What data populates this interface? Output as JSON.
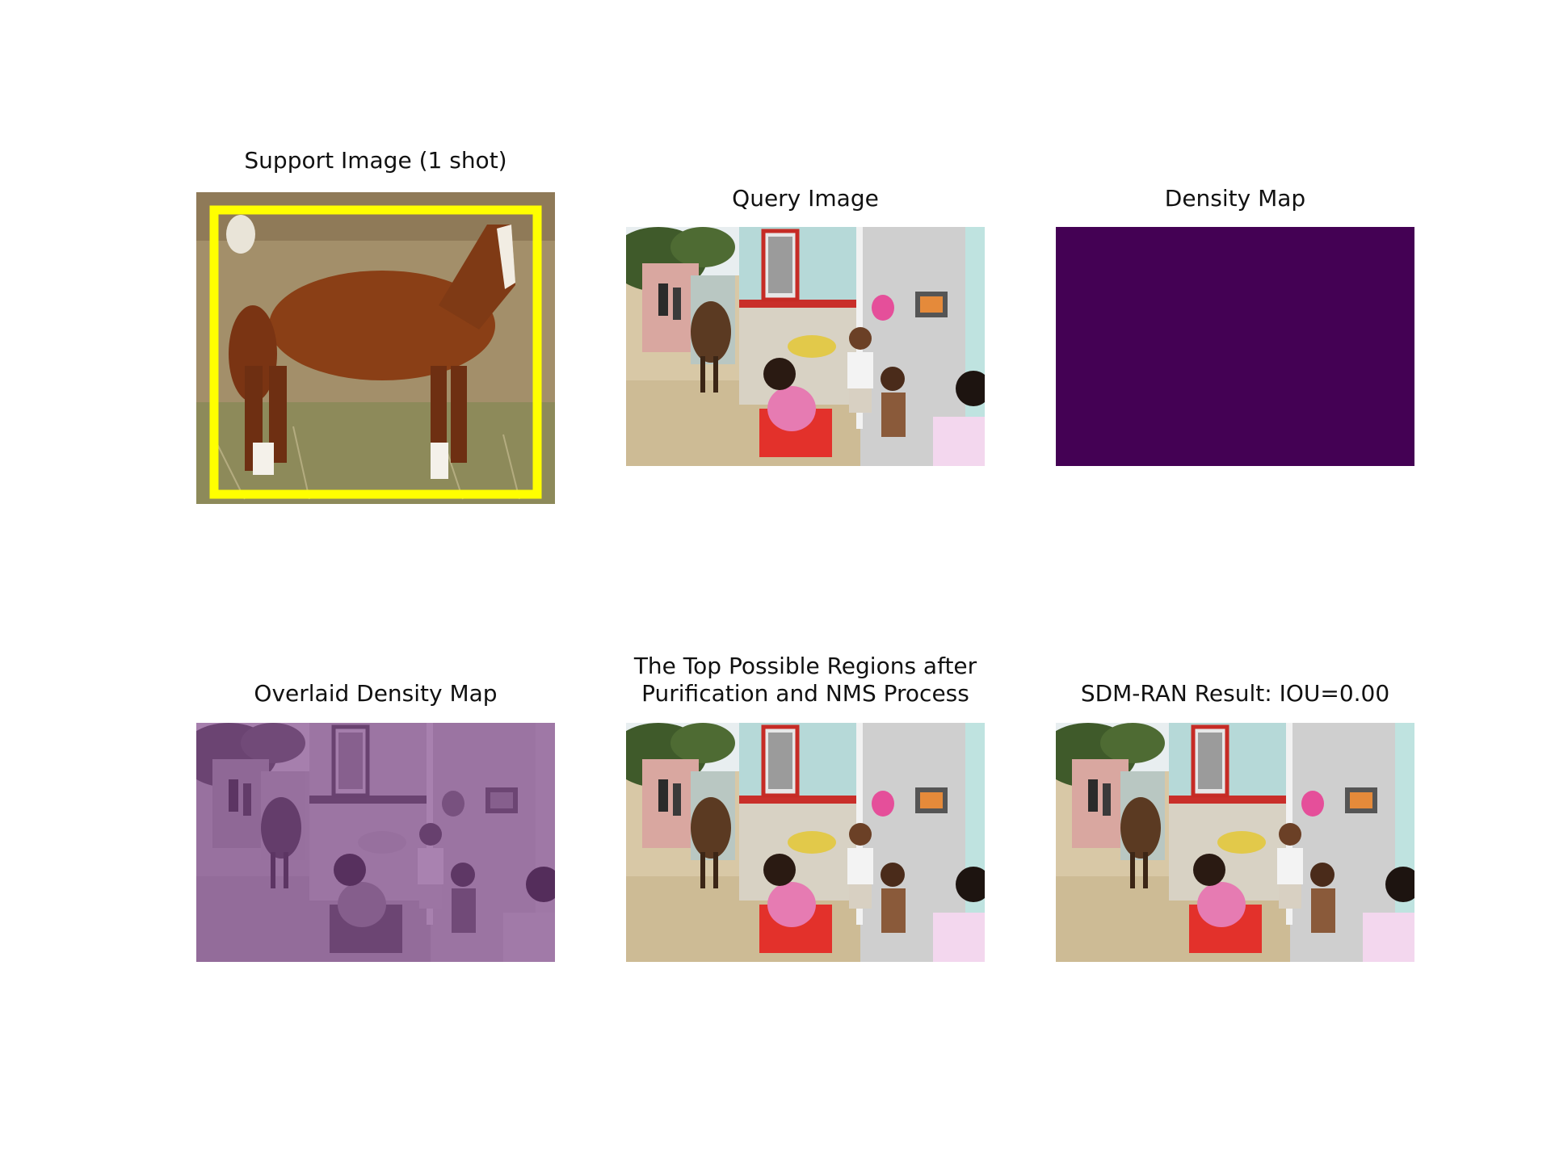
{
  "figure": {
    "panels": [
      {
        "title": "Support Image (1 shot)",
        "image": "horse-with-yellow-box"
      },
      {
        "title": "Query Image",
        "image": "village-scene-horse-children"
      },
      {
        "title": "Density Map",
        "image": "uniform-dark-purple-density",
        "color": "#440154"
      },
      {
        "title": "Overlaid Density Map",
        "image": "village-scene-purple-tint",
        "tint_color": "#7a3b86"
      },
      {
        "title_lines": [
          "The Top Possible Regions after",
          "Purification and NMS Process"
        ],
        "image": "village-scene-horse-children"
      },
      {
        "title": "SDM-RAN Result: IOU=0.00",
        "image": "village-scene-horse-children"
      }
    ],
    "box_color": "#ffff00"
  }
}
